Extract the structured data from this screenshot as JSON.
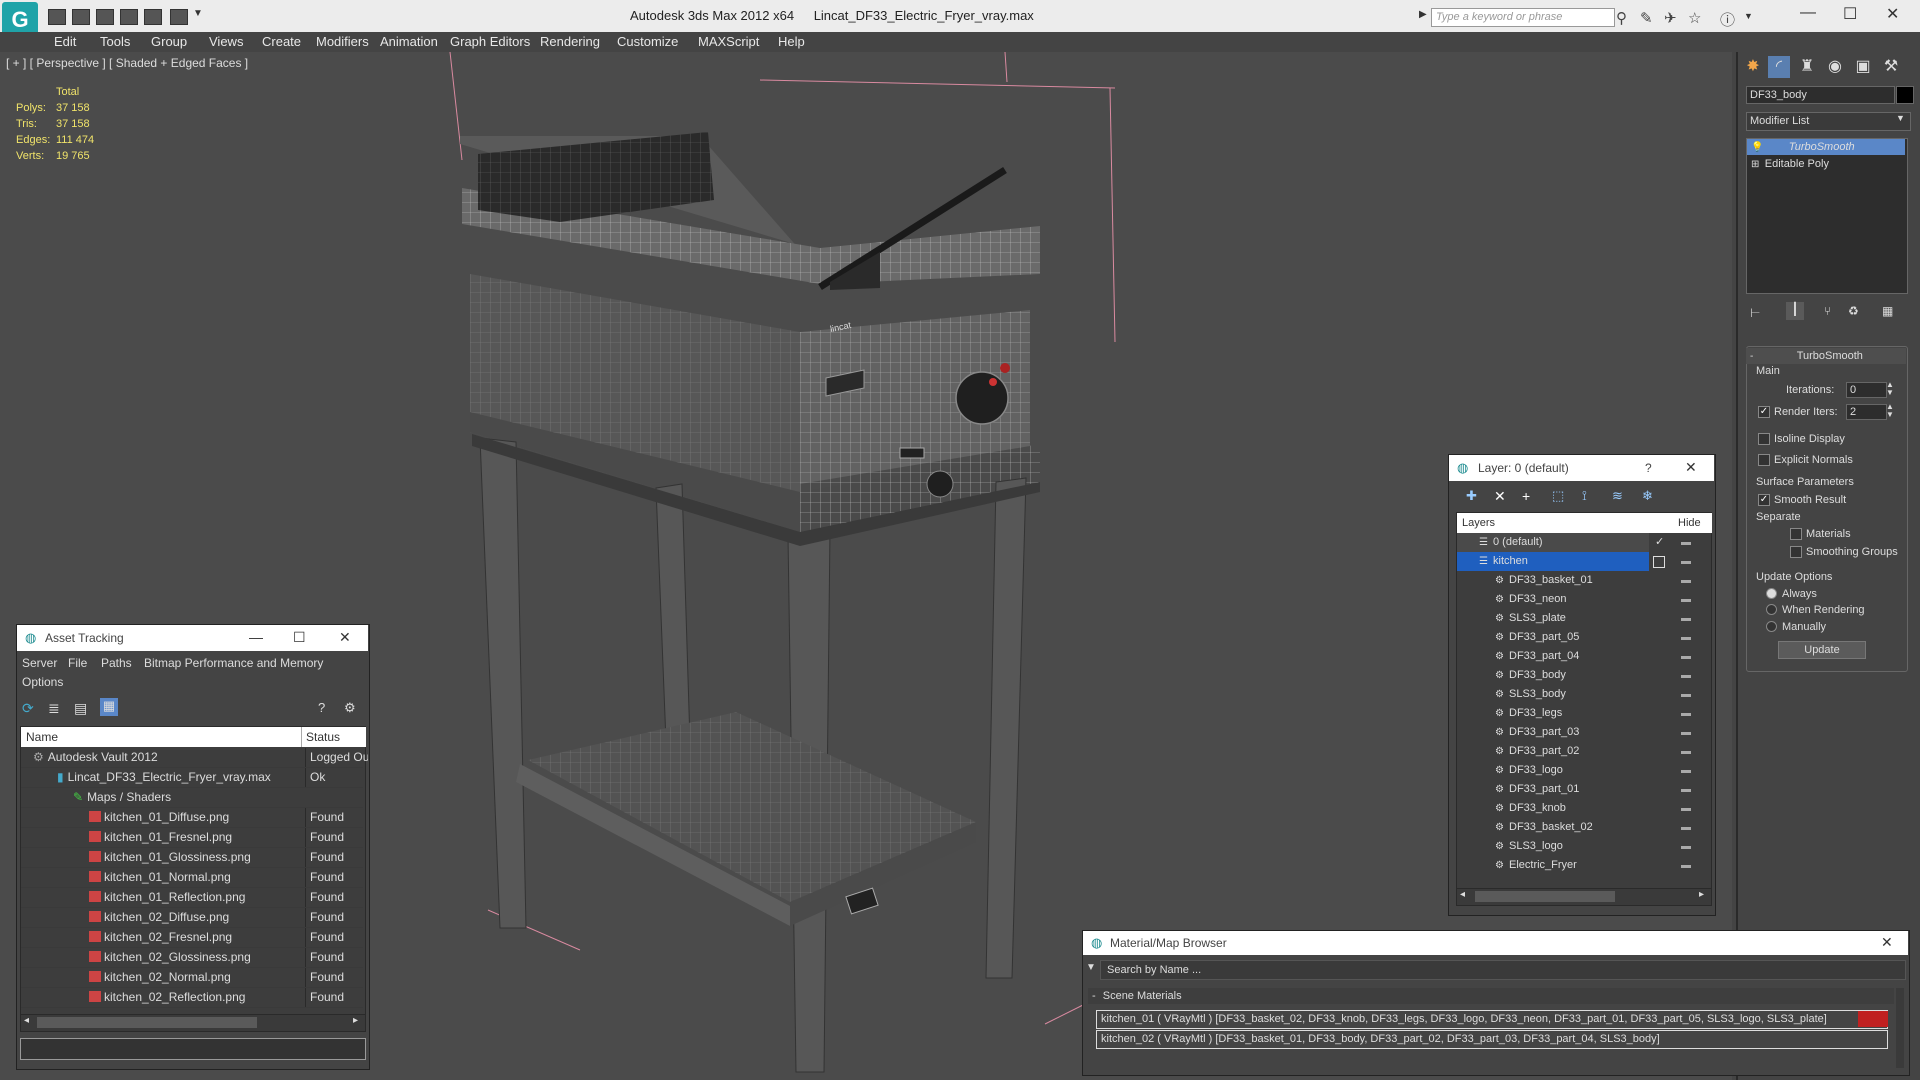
{
  "titlebar": {
    "app_title": "Autodesk 3ds Max  2012 x64",
    "file_title": "Lincat_DF33_Electric_Fryer_vray.max",
    "search_placeholder": "Type a keyword or phrase"
  },
  "menu": [
    "Edit",
    "Tools",
    "Group",
    "Views",
    "Create",
    "Modifiers",
    "Animation",
    "Graph Editors",
    "Rendering",
    "Customize",
    "MAXScript",
    "Help"
  ],
  "viewport": {
    "label": "[ + ] [ Perspective ] [ Shaded + Edged Faces ]",
    "stats": {
      "header": "Total",
      "rows": [
        {
          "k": "Polys:",
          "v": "37 158"
        },
        {
          "k": "Tris:",
          "v": "37 158"
        },
        {
          "k": "Edges:",
          "v": "111 474"
        },
        {
          "k": "Verts:",
          "v": "19 765"
        }
      ]
    },
    "logo_text": "lincat"
  },
  "command_panel": {
    "object_name": "DF33_body",
    "modifier_list": "Modifier List",
    "stack": [
      "TurboSmooth",
      "Editable Poly"
    ],
    "rollout_title": "TurboSmooth",
    "main_label": "Main",
    "iterations_label": "Iterations:",
    "iterations_value": "0",
    "render_iters_label": "Render Iters:",
    "render_iters_value": "2",
    "isoline": "Isoline Display",
    "explicit": "Explicit Normals",
    "surface_params": "Surface Parameters",
    "smooth_result": "Smooth Result",
    "separate": "Separate",
    "materials": "Materials",
    "smoothing_groups": "Smoothing Groups",
    "update_options": "Update Options",
    "always": "Always",
    "when_rendering": "When Rendering",
    "manually": "Manually",
    "update_btn": "Update"
  },
  "asset_tracking": {
    "title": "Asset Tracking",
    "menu": [
      "Server",
      "File",
      "Paths",
      "Bitmap Performance and Memory"
    ],
    "menu2": "Options",
    "col_name": "Name",
    "col_status": "Status",
    "rows": [
      {
        "name": "Autodesk Vault 2012",
        "status": "Logged Out"
      },
      {
        "name": "Lincat_DF33_Electric_Fryer_vray.max",
        "status": "Ok"
      },
      {
        "name": "Maps / Shaders",
        "status": ""
      },
      {
        "name": "kitchen_01_Diffuse.png",
        "status": "Found"
      },
      {
        "name": "kitchen_01_Fresnel.png",
        "status": "Found"
      },
      {
        "name": "kitchen_01_Glossiness.png",
        "status": "Found"
      },
      {
        "name": "kitchen_01_Normal.png",
        "status": "Found"
      },
      {
        "name": "kitchen_01_Reflection.png",
        "status": "Found"
      },
      {
        "name": "kitchen_02_Diffuse.png",
        "status": "Found"
      },
      {
        "name": "kitchen_02_Fresnel.png",
        "status": "Found"
      },
      {
        "name": "kitchen_02_Glossiness.png",
        "status": "Found"
      },
      {
        "name": "kitchen_02_Normal.png",
        "status": "Found"
      },
      {
        "name": "kitchen_02_Reflection.png",
        "status": "Found"
      }
    ]
  },
  "layers": {
    "title": "Layer: 0 (default)",
    "help": "?",
    "col_layers": "Layers",
    "col_hide": "Hide",
    "rows": [
      "0 (default)",
      "kitchen",
      "DF33_basket_01",
      "DF33_neon",
      "SLS3_plate",
      "DF33_part_05",
      "DF33_part_04",
      "DF33_body",
      "SLS3_body",
      "DF33_legs",
      "DF33_part_03",
      "DF33_part_02",
      "DF33_logo",
      "DF33_part_01",
      "DF33_knob",
      "DF33_basket_02",
      "SLS3_logo",
      "Electric_Fryer"
    ]
  },
  "material_browser": {
    "title": "Material/Map Browser",
    "search_placeholder": "Search by Name ...",
    "section": "Scene Materials",
    "rows": [
      "kitchen_01  ( VRayMtl )  [DF33_basket_02, DF33_knob, DF33_legs, DF33_logo, DF33_neon, DF33_part_01, DF33_part_05, SLS3_logo, SLS3_plate]",
      "kitchen_02  ( VRayMtl )  [DF33_basket_01, DF33_body, DF33_part_02, DF33_part_03, DF33_part_04, SLS3_body]"
    ]
  }
}
